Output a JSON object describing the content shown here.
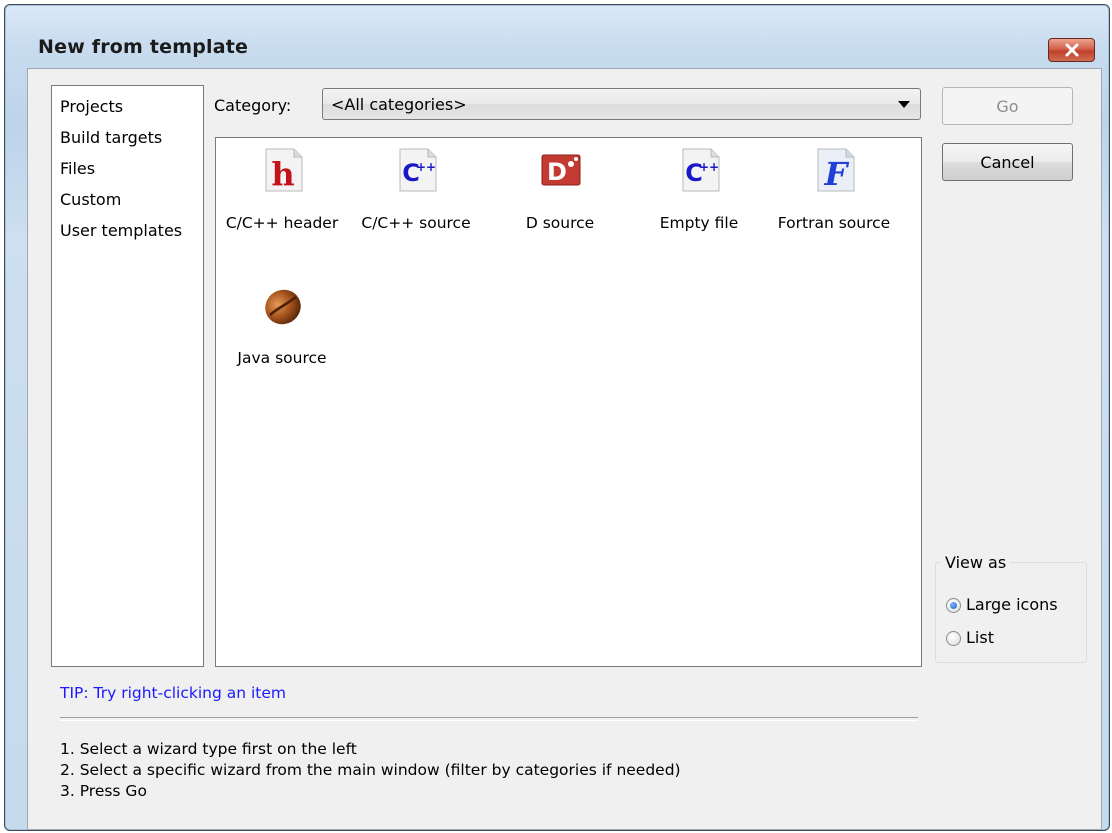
{
  "window": {
    "title": "New from template"
  },
  "sidebar": {
    "items": [
      {
        "label": "Projects"
      },
      {
        "label": "Build targets"
      },
      {
        "label": "Files"
      },
      {
        "label": "Custom"
      },
      {
        "label": "User templates"
      }
    ]
  },
  "category": {
    "label": "Category:",
    "selected": "<All categories>"
  },
  "templates": [
    {
      "label": "C/C++ header",
      "icon": "c-header-icon"
    },
    {
      "label": "C/C++ source",
      "icon": "cpp-source-icon"
    },
    {
      "label": "D source",
      "icon": "d-source-icon"
    },
    {
      "label": "Empty file",
      "icon": "empty-file-icon"
    },
    {
      "label": "Fortran source",
      "icon": "fortran-source-icon"
    },
    {
      "label": "Java source",
      "icon": "java-bean-icon"
    }
  ],
  "buttons": {
    "go": "Go",
    "cancel": "Cancel"
  },
  "view_as": {
    "label": "View as",
    "options": [
      {
        "label": "Large icons",
        "selected": true
      },
      {
        "label": "List",
        "selected": false
      }
    ]
  },
  "tip": "TIP: Try right-clicking an item",
  "steps": [
    "1. Select a wizard type first on the left",
    "2. Select a specific wizard from the main window (filter by categories if needed)",
    "3. Press Go"
  ],
  "colors": {
    "tip_text": "#1a1aff",
    "close_button": "#c9452f",
    "c_header_red": "#c4121a",
    "cpp_blue": "#1818c8",
    "d_red": "#c23a32",
    "fortran_blue": "#1f3fd6"
  }
}
